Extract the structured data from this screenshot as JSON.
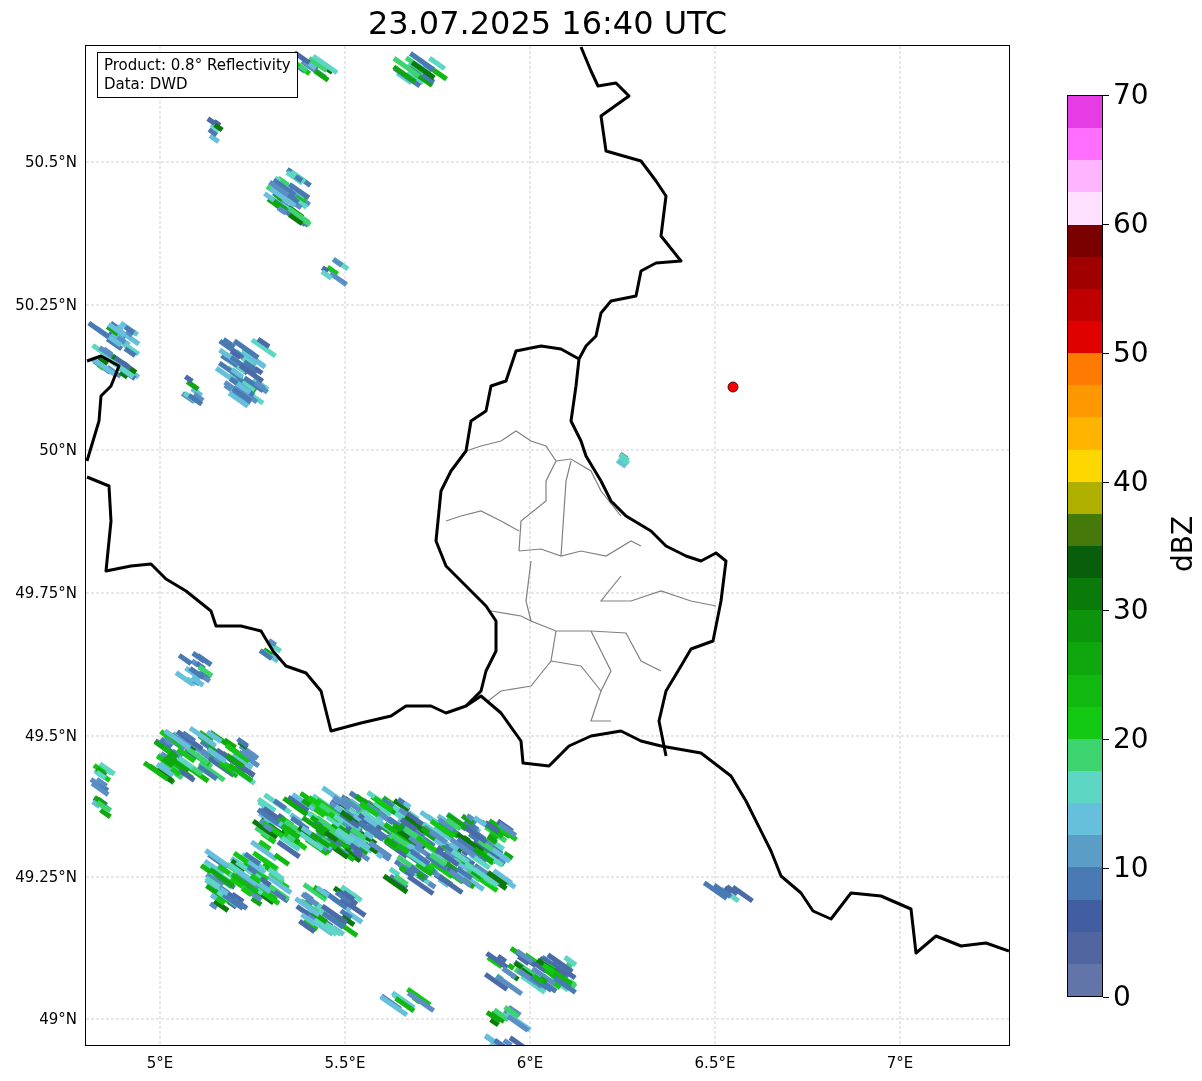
{
  "title": "23.07.2025 16:40 UTC",
  "legend": [
    "Product: 0.8° Reflectivity",
    "Data: DWD"
  ],
  "x_ticks": [
    "5°E",
    "5.5°E",
    "6°E",
    "6.5°E",
    "7°E"
  ],
  "y_ticks": [
    "50.5°N",
    "50.25°N",
    "50°N",
    "49.75°N",
    "49.5°N",
    "49.25°N",
    "49°N"
  ],
  "colorbar": {
    "label": "dBZ",
    "ticks": [
      "70",
      "60",
      "50",
      "40",
      "30",
      "20",
      "10",
      "0"
    ],
    "segments": [
      {
        "color": "#6374a8"
      },
      {
        "color": "#5166a0"
      },
      {
        "color": "#425ea2"
      },
      {
        "color": "#4a7ab4"
      },
      {
        "color": "#5a9ec8"
      },
      {
        "color": "#66c0dc"
      },
      {
        "color": "#5ed6c4"
      },
      {
        "color": "#3cd46e"
      },
      {
        "color": "#12c812"
      },
      {
        "color": "#10b810"
      },
      {
        "color": "#0ea80e"
      },
      {
        "color": "#0c940c"
      },
      {
        "color": "#0a7a0a"
      },
      {
        "color": "#085e0a"
      },
      {
        "color": "#457a0a"
      },
      {
        "color": "#afaf00"
      },
      {
        "color": "#ffd700"
      },
      {
        "color": "#ffb400"
      },
      {
        "color": "#ff9800"
      },
      {
        "color": "#ff7a00"
      },
      {
        "color": "#e00000"
      },
      {
        "color": "#c00000"
      },
      {
        "color": "#a00000"
      },
      {
        "color": "#7a0000"
      },
      {
        "color": "#ffe0ff"
      },
      {
        "color": "#ffb4ff"
      },
      {
        "color": "#ff6eff"
      },
      {
        "color": "#e63ce6"
      }
    ]
  }
}
